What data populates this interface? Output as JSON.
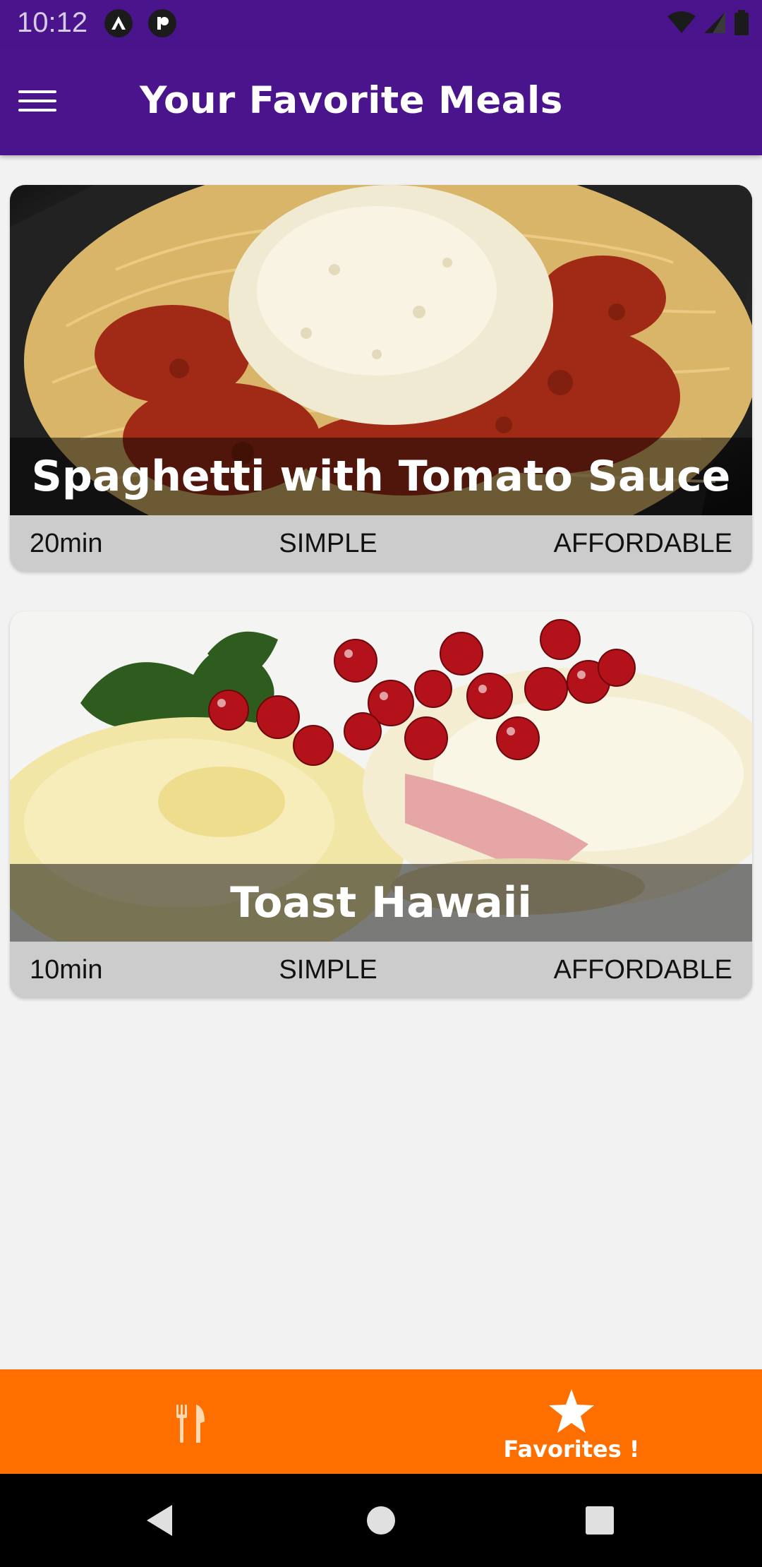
{
  "status_bar": {
    "time": "10:12"
  },
  "app_bar": {
    "title": "Your Favorite Meals"
  },
  "meals": [
    {
      "title": "Spaghetti with Tomato Sauce",
      "duration": "20min",
      "complexity": "SIMPLE",
      "affordability": "AFFORDABLE"
    },
    {
      "title": "Toast Hawaii",
      "duration": "10min",
      "complexity": "SIMPLE",
      "affordability": "AFFORDABLE"
    }
  ],
  "tab_bar": {
    "tabs": [
      {
        "icon": "restaurant-icon",
        "label": ""
      },
      {
        "icon": "star-icon",
        "label": "Favorites !"
      }
    ],
    "active_tab": 1
  },
  "colors": {
    "primary": "#4a148c",
    "accent": "#ff6f00",
    "background": "#f2f2f2"
  }
}
